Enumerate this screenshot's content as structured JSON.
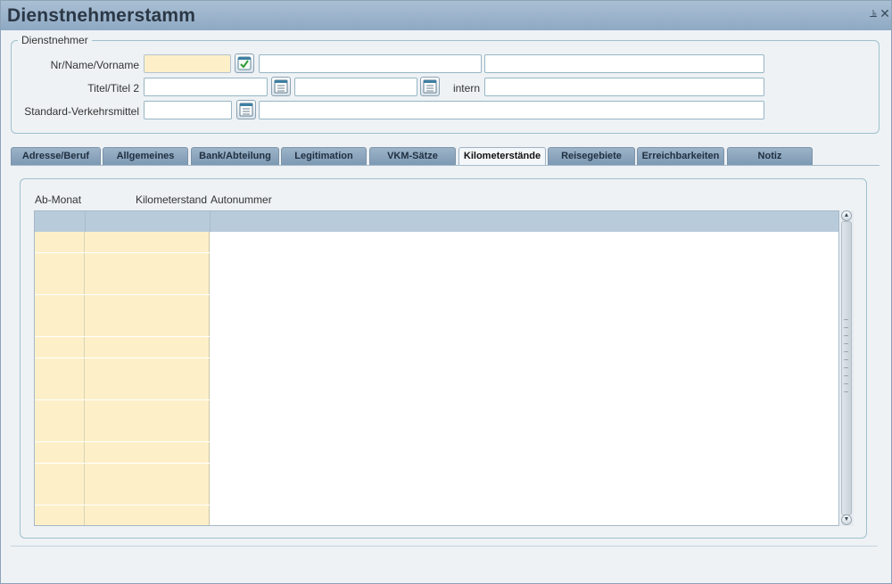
{
  "window": {
    "title": "Dienstnehmerstamm",
    "minimize_icon": "pin-icon",
    "close_icon": "close-icon"
  },
  "group": {
    "legend": "Dienstnehmer",
    "rows": [
      {
        "label": "Nr/Name/Vorname",
        "fields": [
          "",
          "",
          ""
        ]
      },
      {
        "label": "Titel/Titel 2",
        "fields": [
          "",
          "",
          ""
        ],
        "inline_label": "intern"
      },
      {
        "label": "Standard-Verkehrsmittel",
        "fields": [
          "",
          ""
        ]
      }
    ]
  },
  "tabs": [
    {
      "label": "Adresse/Beruf",
      "active": false
    },
    {
      "label": "Allgemeines",
      "active": false
    },
    {
      "label": "Bank/Abteilung",
      "active": false
    },
    {
      "label": "Legitimation",
      "active": false
    },
    {
      "label": "VKM-Sätze",
      "active": false
    },
    {
      "label": "Kilometerstände",
      "active": true
    },
    {
      "label": "Reisegebiete",
      "active": false
    },
    {
      "label": "Erreichbarkeiten",
      "active": false
    },
    {
      "label": "Notiz",
      "active": false
    }
  ],
  "grid": {
    "columns": [
      "Ab-Monat",
      "Kilometerstand",
      "Autonummer"
    ],
    "rows": [
      [
        "",
        "",
        ""
      ],
      [
        "",
        "",
        ""
      ],
      [
        "",
        "",
        ""
      ],
      [
        "",
        "",
        ""
      ],
      [
        "",
        "",
        ""
      ],
      [
        "",
        "",
        ""
      ],
      [
        "",
        "",
        ""
      ],
      [
        "",
        "",
        ""
      ],
      [
        "",
        "",
        ""
      ],
      [
        "",
        "",
        ""
      ],
      [
        "",
        "",
        ""
      ],
      [
        "",
        "",
        ""
      ],
      [
        "",
        "",
        ""
      ],
      [
        "",
        "",
        ""
      ]
    ]
  },
  "colors": {
    "titlebar": "#8fa9c3",
    "required_field": "#fdf0c8",
    "grid_header": "#b8cbdb",
    "accent_border": "#9fc1cc"
  }
}
